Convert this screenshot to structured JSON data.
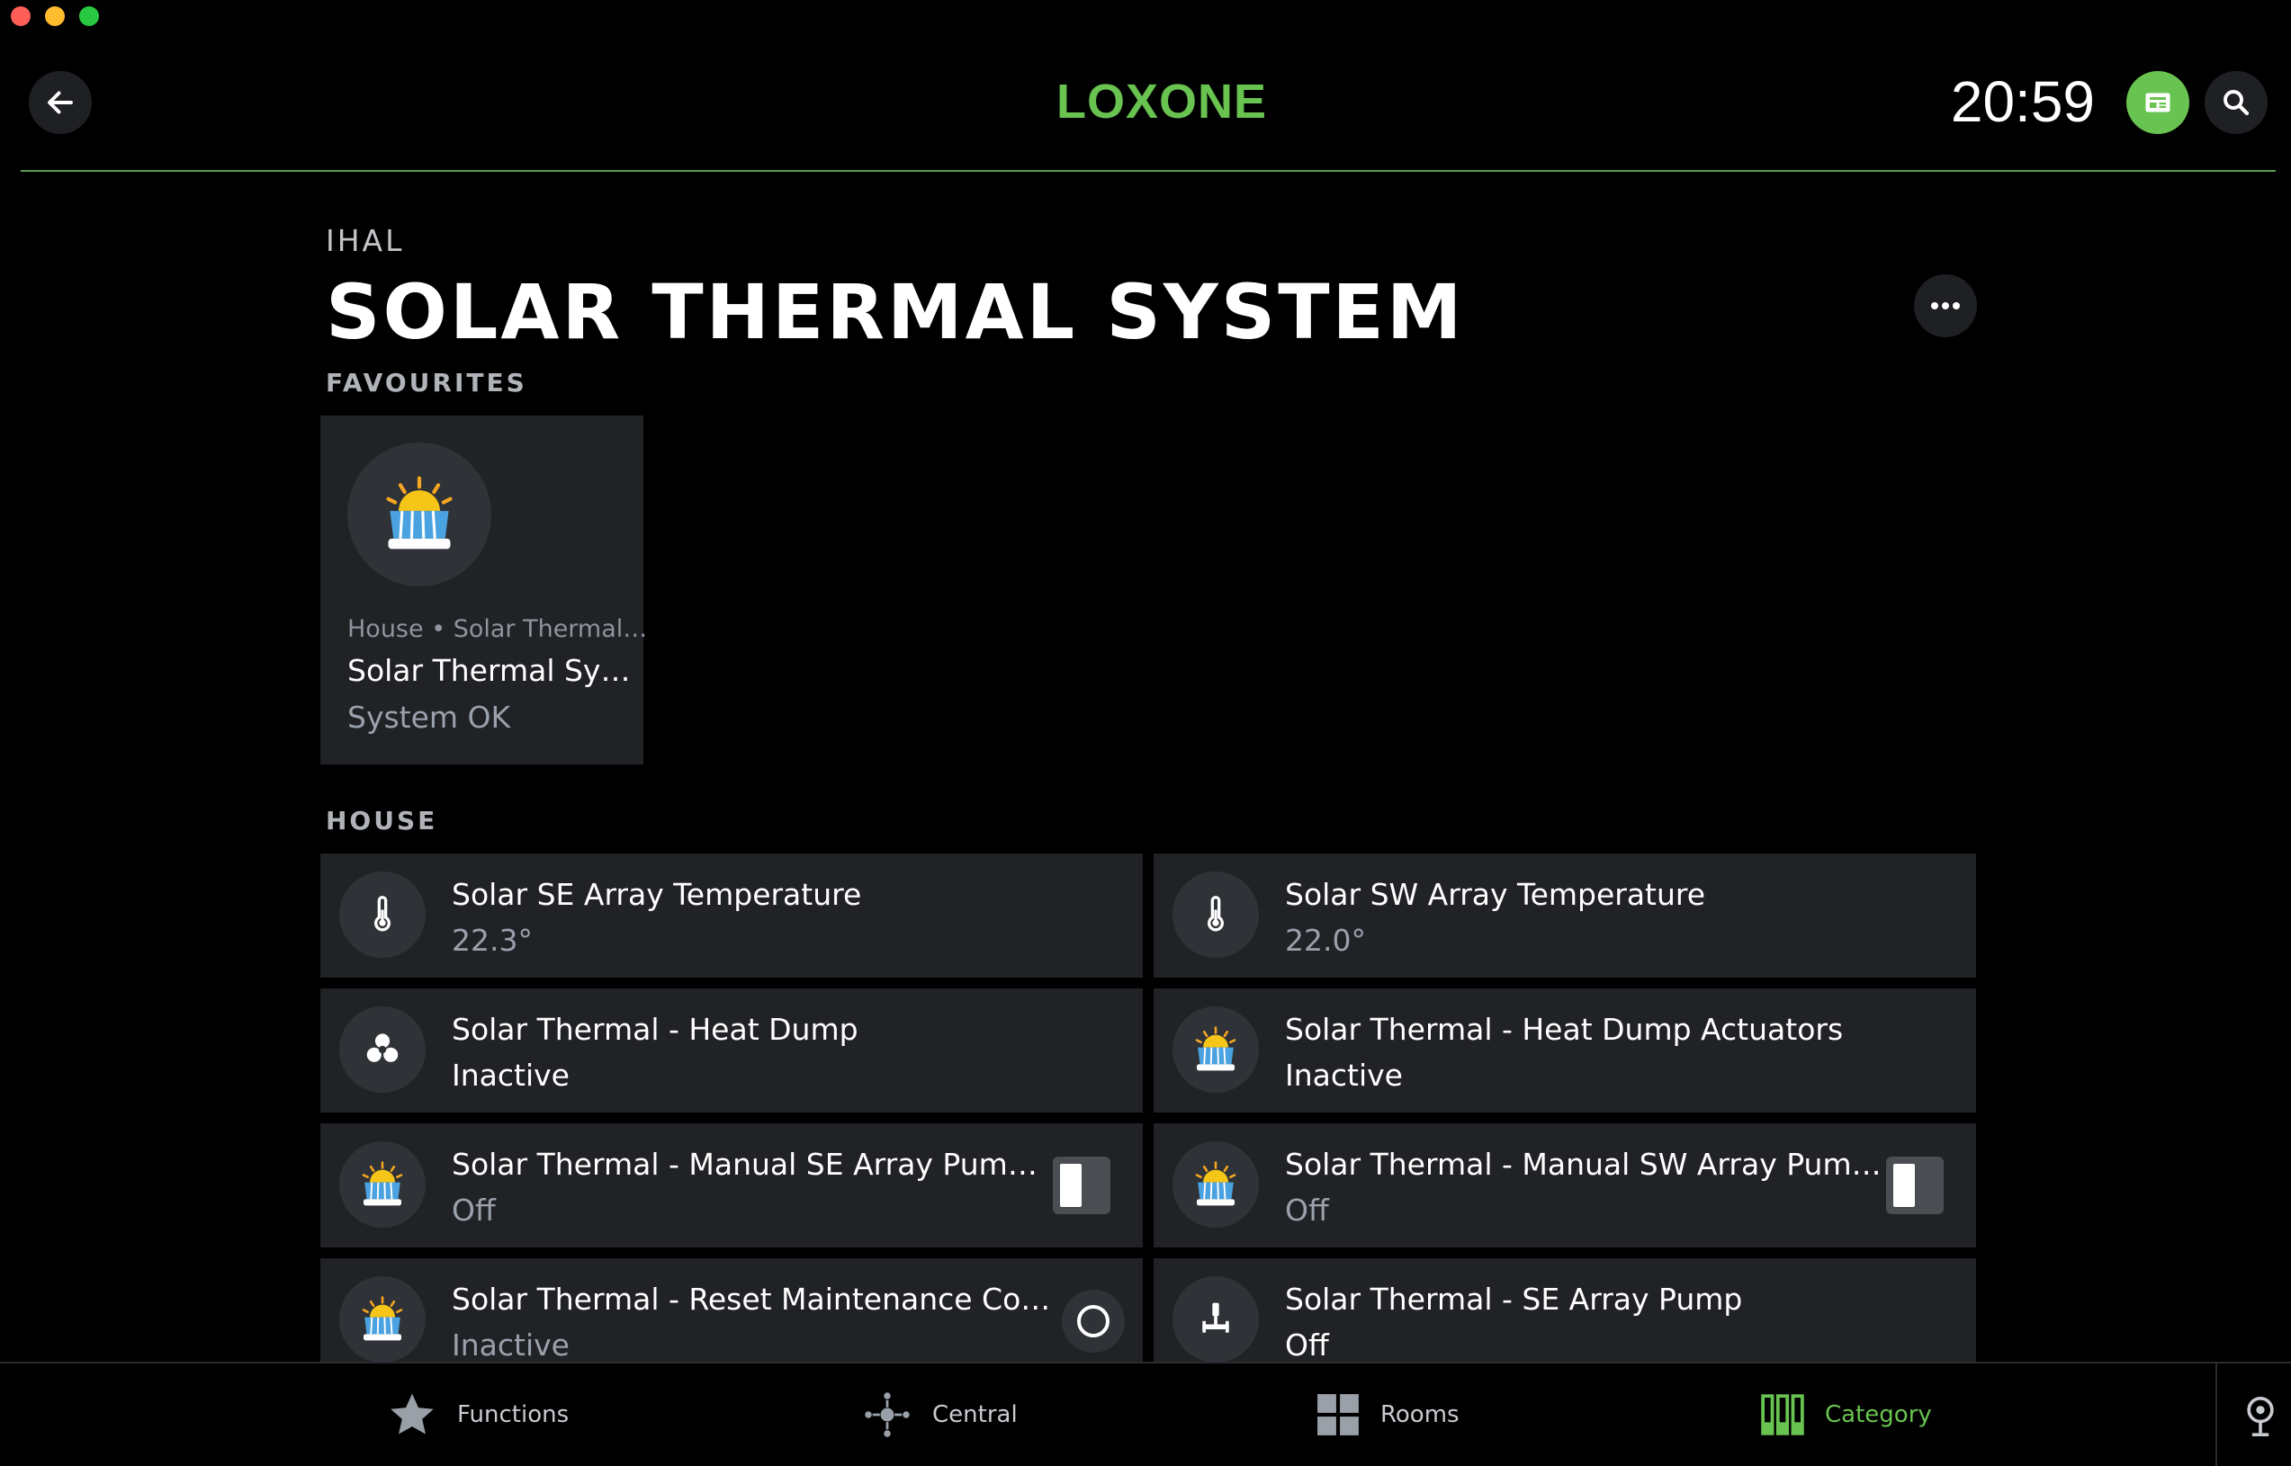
{
  "window": {
    "controls": [
      {
        "name": "close",
        "color": "#ff5f57"
      },
      {
        "name": "minimize",
        "color": "#febc2e"
      },
      {
        "name": "zoom",
        "color": "#28c840"
      }
    ]
  },
  "header": {
    "logo": "LOXONE",
    "time": "20:59",
    "back_icon": "arrow-left-icon",
    "notifications_icon": "news-icon",
    "search_icon": "search-icon",
    "accent_color": "#69c350"
  },
  "page": {
    "breadcrumb": "IHAL",
    "title": "SOLAR THERMAL SYSTEM",
    "more_icon": "more-dots-icon"
  },
  "favourites": {
    "label": "FAVOURITES",
    "items": [
      {
        "location": "House • Solar Thermal…",
        "name": "Solar Thermal Sy…",
        "status": "System OK",
        "icon": "solar-thermal-icon"
      }
    ]
  },
  "house": {
    "label": "HOUSE",
    "items": [
      {
        "name": "Solar SE Array Temperature",
        "state": "22.3°",
        "icon": "thermometer-icon"
      },
      {
        "name": "Solar SW Array Temperature",
        "state": "22.0°",
        "icon": "thermometer-icon"
      },
      {
        "name": "Solar Thermal - Heat Dump",
        "state": "Inactive",
        "icon": "fan-icon"
      },
      {
        "name": "Solar Thermal - Heat Dump Actuators",
        "state": "Inactive",
        "icon": "solar-thermal-icon"
      },
      {
        "name": "Solar Thermal - Manual SE Array Pum…",
        "state": "Off",
        "icon": "solar-thermal-icon",
        "control": "switch"
      },
      {
        "name": "Solar Thermal - Manual SW Array Pum…",
        "state": "Off",
        "icon": "solar-thermal-icon",
        "control": "switch"
      },
      {
        "name": "Solar Thermal - Reset Maintenance Co…",
        "state": "Inactive",
        "icon": "solar-thermal-icon",
        "control": "radio"
      },
      {
        "name": "Solar Thermal - SE Array Pump",
        "state": "Off",
        "icon": "pump-icon"
      }
    ]
  },
  "tabbar": {
    "tabs": [
      {
        "label": "Functions",
        "icon": "star-icon",
        "active": false
      },
      {
        "label": "Central",
        "icon": "central-icon",
        "active": false
      },
      {
        "label": "Rooms",
        "icon": "rooms-icon",
        "active": false
      },
      {
        "label": "Category",
        "icon": "category-icon",
        "active": true
      }
    ],
    "location_icon": "location-pin-icon"
  }
}
